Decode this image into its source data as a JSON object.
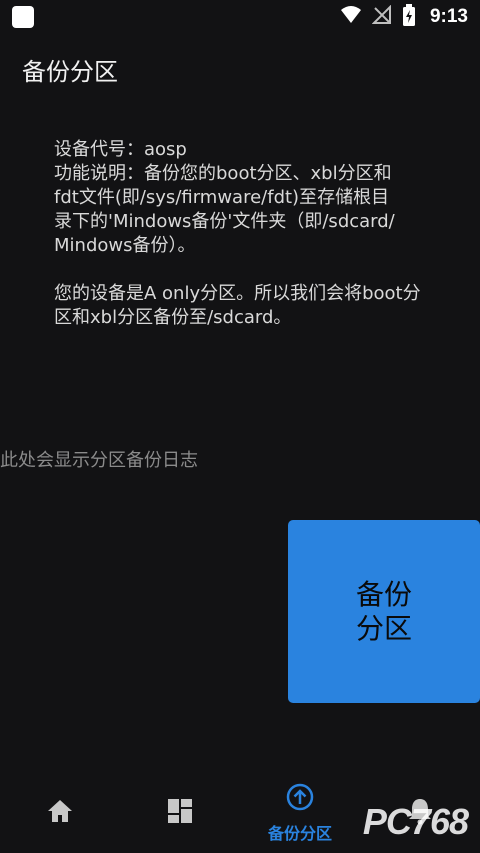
{
  "status_bar": {
    "time": "9:13"
  },
  "app": {
    "title": "备份分区"
  },
  "info": {
    "device_line": "设备代号：aosp",
    "description_lines": [
      "功能说明：备份您的boot分区、xbl分区和",
      "fdt文件(即/sys/firmware/fdt)至存储根目",
      "录下的'Mindows备份'文件夹（即/sdcard/",
      "Mindows备份）。"
    ],
    "result_lines": [
      "您的设备是A only分区。所以我们会将boot分",
      "区和xbl分区备份至/sdcard。"
    ]
  },
  "log": {
    "placeholder": "此处会显示分区备份日志"
  },
  "backup_button": {
    "line1": "备份",
    "line2": "分区"
  },
  "bottom_nav": {
    "items": [
      {
        "icon": "home-icon"
      },
      {
        "icon": "dashboard-icon"
      },
      {
        "icon": "backup-upload-icon",
        "label": "备份分区"
      },
      {
        "icon": "bell-icon"
      }
    ]
  },
  "watermark": {
    "text": "PC768"
  },
  "colors": {
    "background": "#121214",
    "accent": "#2a83df",
    "text": "#d9d9d9",
    "muted_text": "#8b8b8b"
  }
}
